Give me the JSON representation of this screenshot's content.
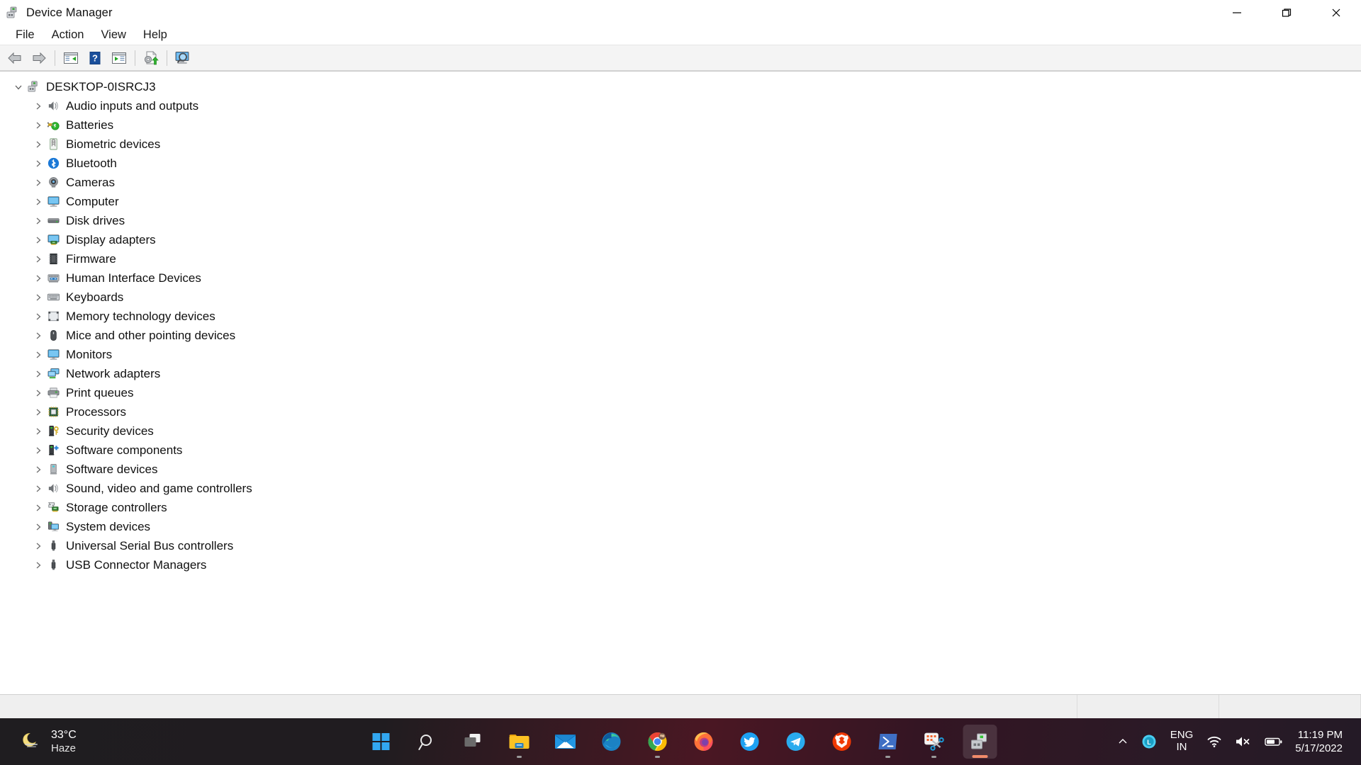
{
  "window": {
    "title": "Device Manager",
    "app_icon": "device-manager-icon",
    "controls": {
      "minimize": "Minimize",
      "maximize": "Restore",
      "close": "Close"
    }
  },
  "menubar": {
    "items": [
      {
        "label": "File",
        "name": "menu-file"
      },
      {
        "label": "Action",
        "name": "menu-action"
      },
      {
        "label": "View",
        "name": "menu-view"
      },
      {
        "label": "Help",
        "name": "menu-help"
      }
    ]
  },
  "toolbar": {
    "buttons": [
      {
        "name": "back-button",
        "icon": "back-arrow-icon",
        "tooltip": "Back"
      },
      {
        "name": "forward-button",
        "icon": "forward-arrow-icon",
        "tooltip": "Forward"
      },
      {
        "name": "show-hide-console-tree-button",
        "icon": "console-tree-icon",
        "tooltip": "Show/Hide Console Tree"
      },
      {
        "name": "help-button",
        "icon": "help-question-icon",
        "tooltip": "Help"
      },
      {
        "name": "properties-button",
        "icon": "properties-icon",
        "tooltip": "Properties"
      },
      {
        "name": "update-driver-button",
        "icon": "update-driver-icon",
        "tooltip": "Update driver"
      },
      {
        "name": "scan-hardware-changes-button",
        "icon": "scan-hardware-changes-icon",
        "tooltip": "Scan for hardware changes"
      }
    ]
  },
  "tree": {
    "root": {
      "label": "DESKTOP-0ISRCJ3",
      "icon": "computer-root-icon",
      "expanded": true
    },
    "nodes": [
      {
        "label": "Audio inputs and outputs",
        "icon": "speaker-icon"
      },
      {
        "label": "Batteries",
        "icon": "battery-plug-icon"
      },
      {
        "label": "Biometric devices",
        "icon": "fingerprint-icon"
      },
      {
        "label": "Bluetooth",
        "icon": "bluetooth-icon"
      },
      {
        "label": "Cameras",
        "icon": "camera-icon"
      },
      {
        "label": "Computer",
        "icon": "monitor-icon"
      },
      {
        "label": "Disk drives",
        "icon": "disk-drive-icon"
      },
      {
        "label": "Display adapters",
        "icon": "display-adapter-icon"
      },
      {
        "label": "Firmware",
        "icon": "firmware-chip-icon"
      },
      {
        "label": "Human Interface Devices",
        "icon": "hid-keyboard-icon"
      },
      {
        "label": "Keyboards",
        "icon": "keyboard-icon"
      },
      {
        "label": "Memory technology devices",
        "icon": "memory-card-icon"
      },
      {
        "label": "Mice and other pointing devices",
        "icon": "mouse-icon"
      },
      {
        "label": "Monitors",
        "icon": "monitor-icon"
      },
      {
        "label": "Network adapters",
        "icon": "network-adapter-icon"
      },
      {
        "label": "Print queues",
        "icon": "printer-icon"
      },
      {
        "label": "Processors",
        "icon": "processor-chip-icon"
      },
      {
        "label": "Security devices",
        "icon": "security-key-icon"
      },
      {
        "label": "Software components",
        "icon": "software-component-icon"
      },
      {
        "label": "Software devices",
        "icon": "software-device-icon"
      },
      {
        "label": "Sound, video and game controllers",
        "icon": "speaker-icon"
      },
      {
        "label": "Storage controllers",
        "icon": "storage-controller-icon"
      },
      {
        "label": "System devices",
        "icon": "system-device-icon"
      },
      {
        "label": "Universal Serial Bus controllers",
        "icon": "usb-icon"
      },
      {
        "label": "USB Connector Managers",
        "icon": "usb-icon"
      }
    ]
  },
  "statusbar": {
    "pane1": "",
    "pane2": "",
    "pane3": ""
  },
  "annotation": {
    "arrow_color": "#f2336d",
    "points_to": "scan-hardware-changes-button"
  },
  "taskbar": {
    "weather": {
      "icon": "moon-haze-icon",
      "temperature": "33°C",
      "condition": "Haze"
    },
    "apps": [
      {
        "name": "start-button",
        "icon": "windows-start-icon",
        "running": false,
        "active": false
      },
      {
        "name": "search-button",
        "icon": "search-icon",
        "running": false,
        "active": false
      },
      {
        "name": "task-view-button",
        "icon": "task-view-icon",
        "running": false,
        "active": false
      },
      {
        "name": "file-explorer-button",
        "icon": "file-explorer-icon",
        "running": true,
        "active": false
      },
      {
        "name": "mail-button",
        "icon": "mail-icon",
        "running": false,
        "active": false
      },
      {
        "name": "edge-button",
        "icon": "edge-icon",
        "running": false,
        "active": false
      },
      {
        "name": "chrome-button",
        "icon": "chrome-icon",
        "running": true,
        "active": false
      },
      {
        "name": "firefox-button",
        "icon": "firefox-icon",
        "running": false,
        "active": false
      },
      {
        "name": "twitter-button",
        "icon": "twitter-icon",
        "running": false,
        "active": false
      },
      {
        "name": "telegram-button",
        "icon": "telegram-icon",
        "running": false,
        "active": false
      },
      {
        "name": "brave-button",
        "icon": "brave-icon",
        "running": false,
        "active": false
      },
      {
        "name": "powershell-button",
        "icon": "powershell-icon",
        "running": true,
        "active": false
      },
      {
        "name": "snipping-tool-button",
        "icon": "snipping-tool-icon",
        "running": true,
        "active": false
      },
      {
        "name": "device-manager-button",
        "icon": "device-manager-icon",
        "running": true,
        "active": true
      }
    ],
    "tray": {
      "overflow": "show-hidden-icons-chevron",
      "lang_line1": "ENG",
      "lang_line2": "IN",
      "network_icon": "wifi-icon",
      "volume_icon": "volume-muted-icon",
      "battery_icon": "battery-icon",
      "time": "11:19 PM",
      "date": "5/17/2022"
    }
  }
}
